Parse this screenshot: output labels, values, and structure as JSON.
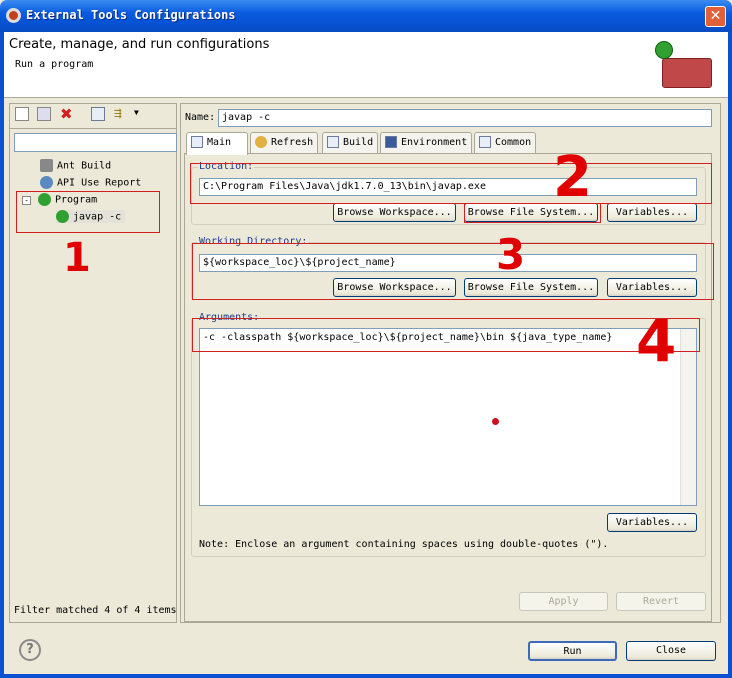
{
  "window": {
    "title": "External Tools Configurations",
    "close_icon": "close-icon"
  },
  "header": {
    "title": "Create, manage, and run configurations",
    "subtitle": "Run a program"
  },
  "left": {
    "toolbar": [
      "new-config-icon",
      "duplicate-icon",
      "delete-icon",
      "collapse-all-icon",
      "filter-icon",
      "dropdown-icon"
    ],
    "filter_value": "",
    "tree": [
      {
        "label": "Ant Build",
        "icon": "ant-icon"
      },
      {
        "label": "API Use Report",
        "icon": "api-report-icon"
      },
      {
        "label": "Program",
        "icon": "program-icon",
        "expanded": true
      },
      {
        "label": "javap -c",
        "icon": "program-icon",
        "selected": true
      }
    ],
    "status": "Filter matched 4 of 4 items"
  },
  "right": {
    "name_label": "Name:",
    "name_value": "javap -c",
    "tabs": [
      {
        "label": "Main",
        "selected": true
      },
      {
        "label": "Refresh"
      },
      {
        "label": "Build"
      },
      {
        "label": "Environment"
      },
      {
        "label": "Common"
      }
    ],
    "location": {
      "label": "Location:",
      "value": "C:\\Program Files\\Java\\jdk1.7.0_13\\bin\\javap.exe",
      "buttons": [
        "Browse Workspace...",
        "Browse File System...",
        "Variables..."
      ]
    },
    "working_dir": {
      "label": "Working Directory:",
      "value": "${workspace_loc}\\${project_name}",
      "buttons": [
        "Browse Workspace...",
        "Browse File System...",
        "Variables..."
      ]
    },
    "arguments": {
      "label": "Arguments:",
      "value": "-c -classpath ${workspace_loc}\\${project_name}\\bin  ${java_type_name}",
      "variables": "Variables...",
      "note": "Note: Enclose an argument containing spaces using double-quotes (\")."
    },
    "apply": "Apply",
    "revert": "Revert"
  },
  "footer": {
    "run": "Run",
    "close": "Close",
    "help_icon": "help-icon"
  },
  "annotations": {
    "n1": "1",
    "n2": "2",
    "n3": "3",
    "n4": "4",
    "color": "#e00000"
  }
}
